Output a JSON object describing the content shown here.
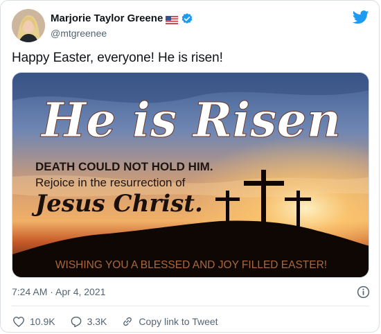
{
  "author": {
    "display_name": "Marjorie Taylor Greene",
    "handle": "@mtgreenee"
  },
  "tweet": {
    "text": "Happy Easter, everyone! He is risen!",
    "timestamp": "7:24 AM · Apr 4, 2021"
  },
  "image": {
    "headline": "He is Risen",
    "line1": "DEATH COULD NOT HOLD HIM.",
    "line2": "Rejoice in the resurrection of",
    "line3": "Jesus Christ.",
    "footer": "WISHING YOU A BLESSED AND JOY FILLED EASTER!"
  },
  "actions": {
    "likes": "10.9K",
    "replies": "3.3K",
    "copy_link": "Copy link to Tweet"
  },
  "colors": {
    "brand": "#1d9bf0",
    "like": "#536471",
    "muted": "#536471"
  },
  "icons": [
    "avatar",
    "us-flag-icon",
    "verified-icon",
    "twitter-bird-icon",
    "info-icon",
    "heart-icon",
    "reply-icon",
    "link-icon"
  ]
}
